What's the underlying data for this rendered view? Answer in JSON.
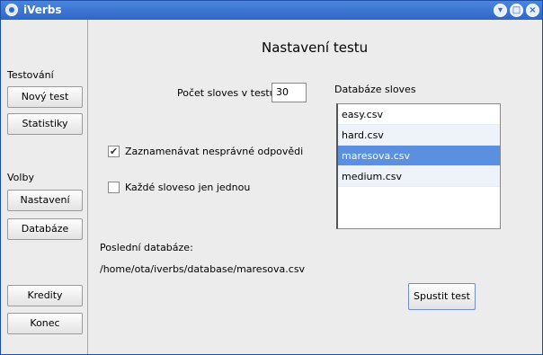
{
  "window": {
    "title": "iVerbs"
  },
  "sidebar": {
    "section_testing": "Testování",
    "new_test": "Nový test",
    "statistics": "Statistiky",
    "section_options": "Volby",
    "settings": "Nastavení",
    "database": "Databáze",
    "credits": "Kredity",
    "quit": "Konec"
  },
  "main": {
    "title": "Nastavení testu",
    "verb_count_label": "Počet sloves v testu:",
    "verb_count_value": "30",
    "record_wrong_label": "Zaznamenávat nesprávné odpovědi",
    "record_wrong_checked": true,
    "each_once_label": "Každé sloveso jen jednou",
    "each_once_checked": false,
    "db_list_title": "Databáze sloves",
    "databases": [
      {
        "name": "easy.csv",
        "selected": false
      },
      {
        "name": "hard.csv",
        "selected": false
      },
      {
        "name": "maresova.csv",
        "selected": true
      },
      {
        "name": "medium.csv",
        "selected": false
      }
    ],
    "last_db_label": "Poslední databáze:",
    "last_db_path": "/home/ota/iverbs/database/maresova.csv",
    "start_button": "Spustit test"
  }
}
